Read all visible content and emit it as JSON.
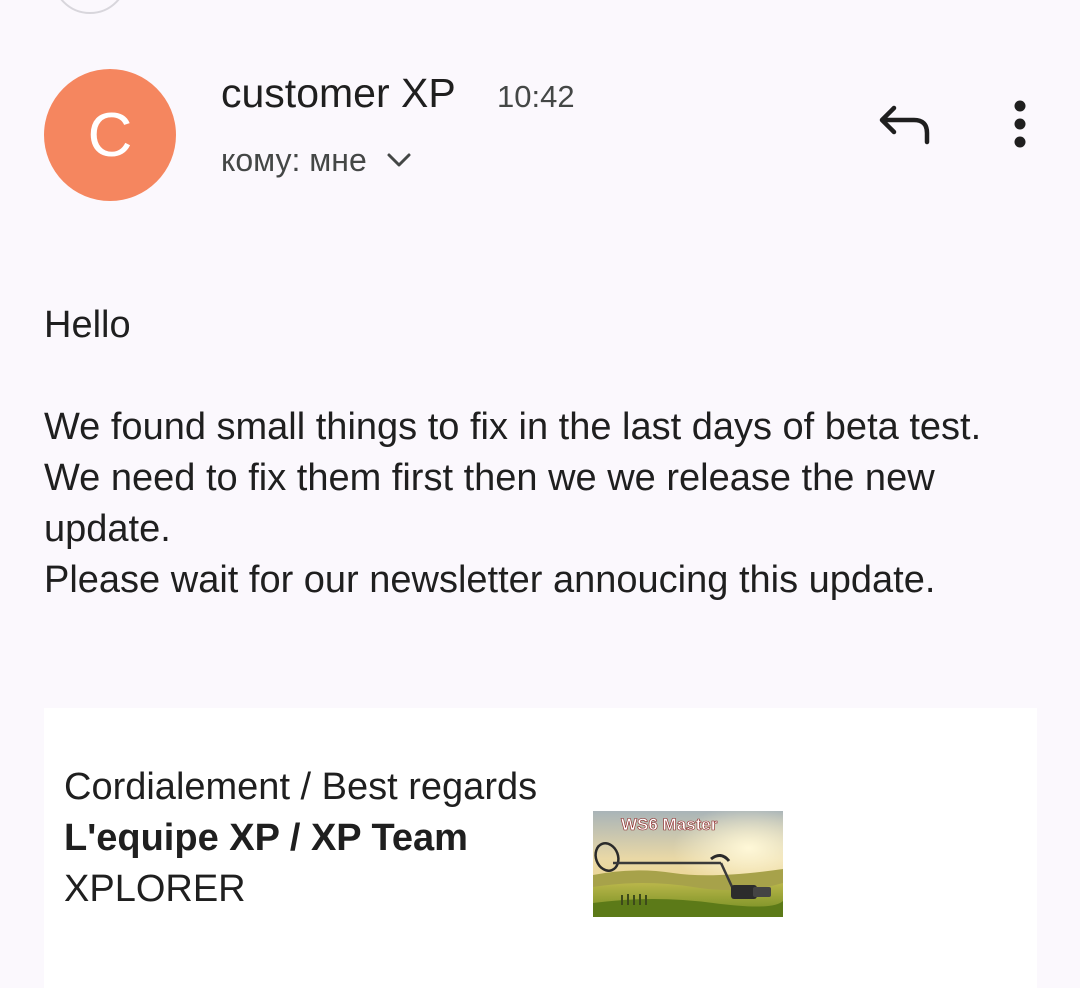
{
  "message": {
    "sender": {
      "avatar_letter": "C",
      "name": "customer XP",
      "time": "10:42"
    },
    "recipient_label": "кому: мне",
    "icons": {
      "avatar_color": "#f5865f",
      "reply": "reply-icon",
      "more": "more-vert-icon",
      "expand": "chevron-down-icon"
    },
    "body": {
      "greeting": "Hello",
      "paragraph_1": "We found small things to fix in the last days of beta test. We need to fix them first then we we release the new update.",
      "paragraph_2": "Please wait for our newsletter annoucing this update."
    },
    "signature": {
      "regards": "Cordialement / Best regards",
      "team": "L'equipe XP / XP Team",
      "company": "XPLORER",
      "image_caption": "WS6 Master"
    }
  }
}
